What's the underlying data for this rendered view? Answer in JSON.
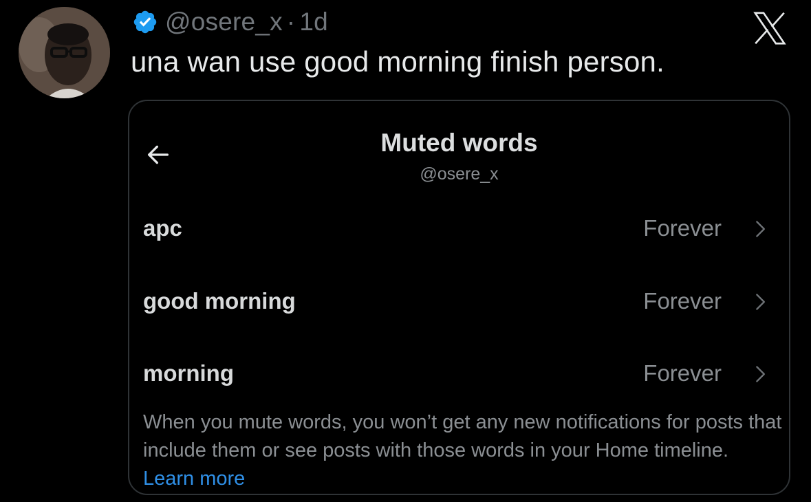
{
  "tweet": {
    "handle": "@osere_x",
    "separator": "·",
    "time_ago": "1d",
    "text": "una wan use good morning finish person."
  },
  "card": {
    "title": "Muted words",
    "subtitle": "@osere_x",
    "muted_words": [
      {
        "word": "apc",
        "duration": "Forever"
      },
      {
        "word": "good morning",
        "duration": "Forever"
      },
      {
        "word": "morning",
        "duration": "Forever"
      }
    ],
    "footnote": "When you mute words, you won’t get any new notifications for posts that include them or see posts with those words in your Home timeline.",
    "footnote_link": "Learn more"
  },
  "icons": {
    "verified": "verified-badge-icon",
    "brand": "x-logo-icon",
    "back": "back-arrow-icon",
    "chevron": "chevron-right-icon"
  },
  "colors": {
    "background": "#000000",
    "verified_blue": "#1d9bf0",
    "link_blue": "#2f8fe6",
    "muted_text": "#71767b"
  }
}
